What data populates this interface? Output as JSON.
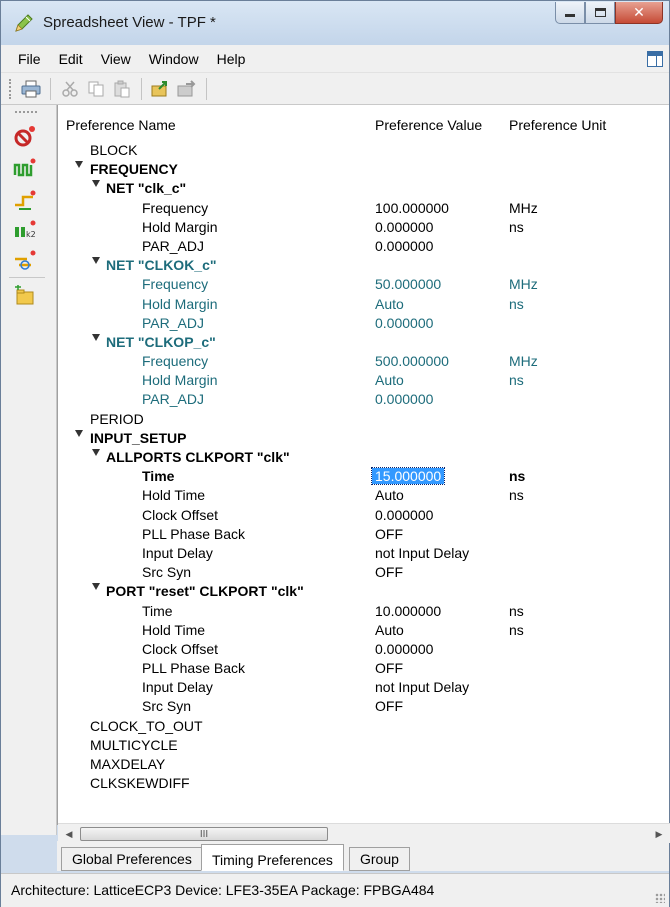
{
  "window": {
    "title": "Spreadsheet View - TPF *"
  },
  "menu": [
    "File",
    "Edit",
    "View",
    "Window",
    "Help"
  ],
  "toolbar": {
    "icons": [
      "print-icon",
      "cut-icon",
      "copy-icon",
      "paste-icon",
      "import-icon",
      "export-icon"
    ]
  },
  "sidebar": {
    "icons": [
      "prohibit-icon",
      "clock-wave-icon",
      "path-icon",
      "waveform-icon",
      "route-icon",
      "folder-add-icon"
    ]
  },
  "table": {
    "columns": [
      "Preference Name",
      "Preference Value",
      "Preference Unit"
    ],
    "rows": [
      {
        "indent": 0,
        "expander": false,
        "name": "BLOCK",
        "value": "",
        "unit": "",
        "style": "normal"
      },
      {
        "indent": 0,
        "expander": true,
        "name": "FREQUENCY",
        "value": "",
        "unit": "",
        "style": "bold"
      },
      {
        "indent": 1,
        "expander": true,
        "name": "NET \"clk_c\"",
        "value": "",
        "unit": "",
        "style": "bold"
      },
      {
        "indent": 2,
        "expander": false,
        "name": "Frequency",
        "value": "100.000000",
        "unit": "MHz",
        "style": "normal"
      },
      {
        "indent": 2,
        "expander": false,
        "name": "Hold Margin",
        "value": "0.000000",
        "unit": "ns",
        "style": "normal"
      },
      {
        "indent": 2,
        "expander": false,
        "name": "PAR_ADJ",
        "value": "0.000000",
        "unit": "",
        "style": "normal"
      },
      {
        "indent": 1,
        "expander": true,
        "name": "NET \"CLKOK_c\"",
        "value": "",
        "unit": "",
        "style": "bold-teal"
      },
      {
        "indent": 2,
        "expander": false,
        "name": "Frequency",
        "value": "50.000000",
        "unit": "MHz",
        "style": "teal"
      },
      {
        "indent": 2,
        "expander": false,
        "name": "Hold Margin",
        "value": "Auto",
        "unit": "ns",
        "style": "teal"
      },
      {
        "indent": 2,
        "expander": false,
        "name": "PAR_ADJ",
        "value": "0.000000",
        "unit": "",
        "style": "teal"
      },
      {
        "indent": 1,
        "expander": true,
        "name": "NET \"CLKOP_c\"",
        "value": "",
        "unit": "",
        "style": "bold-teal"
      },
      {
        "indent": 2,
        "expander": false,
        "name": "Frequency",
        "value": "500.000000",
        "unit": "MHz",
        "style": "teal"
      },
      {
        "indent": 2,
        "expander": false,
        "name": "Hold Margin",
        "value": "Auto",
        "unit": "ns",
        "style": "teal"
      },
      {
        "indent": 2,
        "expander": false,
        "name": "PAR_ADJ",
        "value": "0.000000",
        "unit": "",
        "style": "teal"
      },
      {
        "indent": 0,
        "expander": false,
        "name": "PERIOD",
        "value": "",
        "unit": "",
        "style": "normal"
      },
      {
        "indent": 0,
        "expander": true,
        "name": "INPUT_SETUP",
        "value": "",
        "unit": "",
        "style": "bold"
      },
      {
        "indent": 1,
        "expander": true,
        "name": "ALLPORTS CLKPORT \"clk\"",
        "value": "",
        "unit": "",
        "style": "bold"
      },
      {
        "indent": 2,
        "expander": false,
        "name": "Time",
        "value": "15.000000",
        "unit": "ns",
        "style": "selected"
      },
      {
        "indent": 2,
        "expander": false,
        "name": "Hold Time",
        "value": "Auto",
        "unit": "ns",
        "style": "normal"
      },
      {
        "indent": 2,
        "expander": false,
        "name": "Clock Offset",
        "value": "0.000000",
        "unit": "",
        "style": "normal"
      },
      {
        "indent": 2,
        "expander": false,
        "name": "PLL Phase Back",
        "value": "OFF",
        "unit": "",
        "style": "normal"
      },
      {
        "indent": 2,
        "expander": false,
        "name": "Input Delay",
        "value": "not Input Delay",
        "unit": "",
        "style": "normal"
      },
      {
        "indent": 2,
        "expander": false,
        "name": "Src Syn",
        "value": "OFF",
        "unit": "",
        "style": "normal"
      },
      {
        "indent": 1,
        "expander": true,
        "name": "PORT \"reset\" CLKPORT \"clk\"",
        "value": "",
        "unit": "",
        "style": "bold"
      },
      {
        "indent": 2,
        "expander": false,
        "name": "Time",
        "value": "10.000000",
        "unit": "ns",
        "style": "normal"
      },
      {
        "indent": 2,
        "expander": false,
        "name": "Hold Time",
        "value": "Auto",
        "unit": "ns",
        "style": "normal"
      },
      {
        "indent": 2,
        "expander": false,
        "name": "Clock Offset",
        "value": "0.000000",
        "unit": "",
        "style": "normal"
      },
      {
        "indent": 2,
        "expander": false,
        "name": "PLL Phase Back",
        "value": "OFF",
        "unit": "",
        "style": "normal"
      },
      {
        "indent": 2,
        "expander": false,
        "name": "Input Delay",
        "value": "not Input Delay",
        "unit": "",
        "style": "normal"
      },
      {
        "indent": 2,
        "expander": false,
        "name": "Src Syn",
        "value": "OFF",
        "unit": "",
        "style": "normal"
      },
      {
        "indent": 0,
        "expander": false,
        "name": "CLOCK_TO_OUT",
        "value": "",
        "unit": "",
        "style": "normal"
      },
      {
        "indent": 0,
        "expander": false,
        "name": "MULTICYCLE",
        "value": "",
        "unit": "",
        "style": "normal"
      },
      {
        "indent": 0,
        "expander": false,
        "name": "MAXDELAY",
        "value": "",
        "unit": "",
        "style": "normal"
      },
      {
        "indent": 0,
        "expander": false,
        "name": "CLKSKEWDIFF",
        "value": "",
        "unit": "",
        "style": "normal"
      }
    ]
  },
  "scrollbar": {
    "thumb_label": "III"
  },
  "tabs": [
    "Global Preferences",
    "Timing Preferences",
    "Group"
  ],
  "active_tab": "Timing Preferences",
  "status": "Architecture: LatticeECP3  Device: LFE3-35EA  Package: FPBGA484"
}
